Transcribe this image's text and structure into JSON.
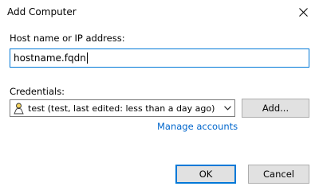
{
  "window": {
    "title": "Add Computer",
    "close_icon": "close-icon"
  },
  "host": {
    "label": "Host name or IP address:",
    "value": "hostname.fqdn"
  },
  "credentials": {
    "label": "Credentials:",
    "selected": "test (test, last edited: less than a day ago)",
    "icon": "user-icon",
    "dropdown_icon": "chevron-down-icon",
    "add_label": "Add...",
    "manage_link": "Manage accounts"
  },
  "footer": {
    "ok_label": "OK",
    "cancel_label": "Cancel"
  },
  "colors": {
    "accent": "#0078d7",
    "link": "#0066cc",
    "button_bg": "#e1e1e1",
    "button_border": "#adadad"
  }
}
